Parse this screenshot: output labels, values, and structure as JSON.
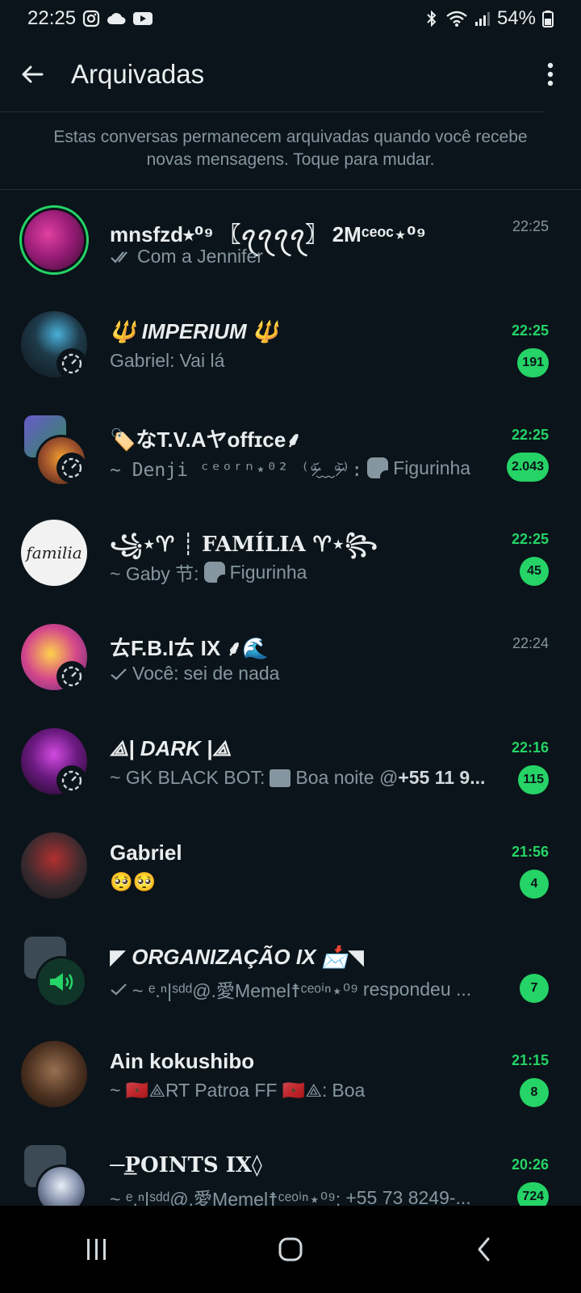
{
  "status_bar": {
    "time": "22:25",
    "battery": "54%"
  },
  "app_bar": {
    "title": "Arquivadas"
  },
  "notice": "Estas conversas permanecem arquivadas quando você recebe novas mensagens. Toque para mudar.",
  "chats": [
    {
      "name": "mnsfzd⭒⁰⁹ 〖ꪖꪖꪖꪖ〗 2Mᶜᵉᵒᶜ⋆⁰⁹",
      "preview_prefix": "",
      "preview": "Com a Jennifer",
      "time": "22:25",
      "unread": ""
    },
    {
      "name": "🔱 IMPERIUM 🔱",
      "preview_prefix": "Gabriel:",
      "preview": "Vai lá",
      "time": "22:25",
      "unread": "191"
    },
    {
      "name": "🏷️なT.V.Aヤoffɪce⸙",
      "preview_prefix": "~ Denji ᶜᵉᵒʳⁿ⋆⁰² ⁽ᵒ̴̶̷᷄﹏ᵒ̴̶̷᷅⁾:",
      "preview": "Figurinha",
      "time": "22:25",
      "unread": "2.043"
    },
    {
      "name": "꧁⋆♈︎ ┊ FAMÍLIA ♈︎⋆꧂",
      "preview_prefix": "~ Gaby 节:",
      "preview": "Figurinha",
      "time": "22:25",
      "unread": "45"
    },
    {
      "name": "ㄊF.B.Iㄊ IX ⸙🌊",
      "preview_prefix": "Você:",
      "preview": "sei de nada",
      "time": "22:24",
      "unread": ""
    },
    {
      "name": "⟁| DARK |⟁",
      "preview_prefix": "~ GK BLACK BOT:",
      "preview": "Boa noite @",
      "preview_bold": "+55 11 9...",
      "time": "22:16",
      "unread": "115"
    },
    {
      "name": "Gabriel",
      "preview_prefix": "",
      "preview": "🥺🥺",
      "time": "21:56",
      "unread": "4"
    },
    {
      "name": "◤ ORGANIZAÇÃO IX 📩◥",
      "preview_prefix": "~ ᵉ.ⁿ|ˢᵈᵈ@.愛Memel☨ᶜᵉᵒⁱⁿ⋆⁰⁹",
      "preview": "respondeu ...",
      "time": "",
      "unread": "7"
    },
    {
      "name": "Ain kokushibo",
      "preview_prefix": "~ 🇲🇦⟁RT Patroa FF 🇲🇦⟁:",
      "preview": "Boa",
      "time": "21:15",
      "unread": "8"
    },
    {
      "name": "─͟POINTS IX◊",
      "preview_prefix": "~ ᵉ.ⁿ|ˢᵈᵈ@.愛Memel☨ᶜᵉᵒⁱⁿ⋆⁰⁹:",
      "preview": "+55 73 8249-...",
      "time": "20:26",
      "unread": "724"
    }
  ],
  "colors": {
    "accent": "#25d366",
    "background": "#0b141a",
    "secondary_text": "#8696a0"
  }
}
